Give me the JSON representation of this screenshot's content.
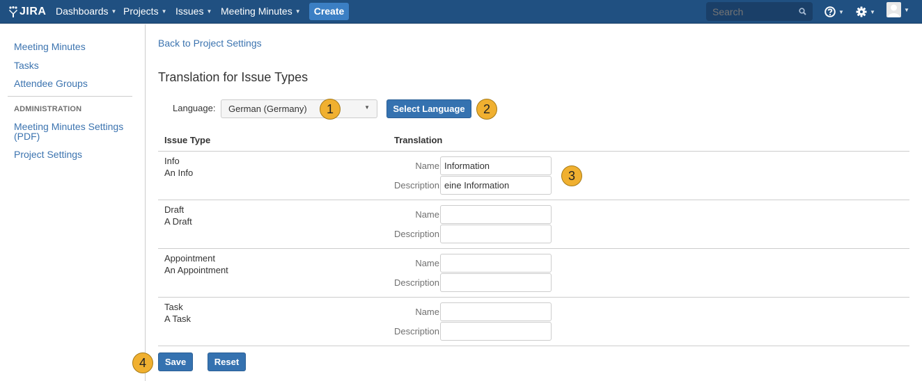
{
  "header": {
    "logo": "JIRA",
    "nav": [
      {
        "label": "Dashboards"
      },
      {
        "label": "Projects"
      },
      {
        "label": "Issues"
      },
      {
        "label": "Meeting Minutes"
      }
    ],
    "create_label": "Create",
    "search_placeholder": "Search",
    "icons": [
      "help-icon",
      "settings-icon",
      "user-avatar"
    ]
  },
  "sidebar": {
    "items": [
      {
        "label": "Meeting Minutes"
      },
      {
        "label": "Tasks"
      },
      {
        "label": "Attendee Groups"
      }
    ],
    "admin_heading": "ADMINISTRATION",
    "admin_items": [
      {
        "label": "Meeting Minutes Settings (PDF)"
      },
      {
        "label": "Project Settings"
      }
    ]
  },
  "main": {
    "back_link": "Back to Project Settings",
    "title": "Translation for Issue Types",
    "language_label": "Language:",
    "language_value": "German (Germany)",
    "select_language_label": "Select Language",
    "columns": [
      "Issue Type",
      "Translation"
    ],
    "field_labels": {
      "name": "Name",
      "description": "Description"
    },
    "rows": [
      {
        "name": "Info",
        "description": "An Info",
        "translated_name": "Information",
        "translated_description": "eine Information"
      },
      {
        "name": "Draft",
        "description": "A Draft",
        "translated_name": "",
        "translated_description": ""
      },
      {
        "name": "Appointment",
        "description": "An Appointment",
        "translated_name": "",
        "translated_description": ""
      },
      {
        "name": "Task",
        "description": "A Task",
        "translated_name": "",
        "translated_description": ""
      }
    ],
    "save_label": "Save",
    "reset_label": "Reset"
  },
  "annotations": [
    "1",
    "2",
    "3",
    "4"
  ],
  "colors": {
    "header_bg": "#205081",
    "create_button": "#3b7fc4",
    "primary_button": "#3572b0",
    "link": "#3b73af",
    "badge": "#f0b030"
  }
}
